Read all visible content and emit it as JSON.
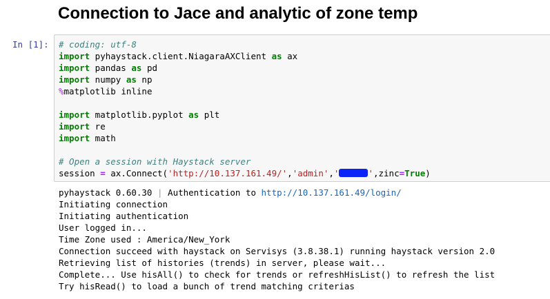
{
  "heading": "Connection to Jace and analytic of zone temp",
  "cell": {
    "prompt": "In [1]:",
    "code": {
      "l1_comment": "# coding: utf-8",
      "kw_import": "import",
      "kw_as": "as",
      "l2_module": " pyhaystack.client.NiagaraAXClient ",
      "l2_alias": " ax",
      "l3_module": " pandas ",
      "l3_alias": " pd",
      "l4_module": " numpy ",
      "l4_alias": " np",
      "l5_magic": "%",
      "l5_rest": "matplotlib inline",
      "l7_module": " matplotlib.pyplot ",
      "l7_alias": " plt",
      "l8_module": " re",
      "l9_module": " math",
      "l11_comment": "# Open a session with Haystack server",
      "l12_a": "session ",
      "l12_eq": "=",
      "l12_b": " ax.Connect(",
      "l12_url": "'http://10.137.161.49/'",
      "l12_comma1": ",",
      "l12_user": "'admin'",
      "l12_comma2": ",",
      "l12_pw_open": "'",
      "l12_pw_close": "'",
      "l12_c": ",zinc",
      "l12_eq2": "=",
      "l12_true": "True",
      "l12_close": ")"
    }
  },
  "output": {
    "line1_a": "pyhaystack 0.60.30 ",
    "line1_sep": "|",
    "line1_b": " Authentication to ",
    "line1_url": "http://10.137.161.49/login/",
    "lines": [
      "Initiating connection",
      "Initiating authentication",
      "User logged in...",
      "Time Zone used : America/New_York",
      "Connection succeed with haystack on Servisys (3.8.38.1) running haystack version 2.0",
      "Retrieving list of histories (trends) in server, please wait...",
      "Complete... Use hisAll() to check for trends or refreshHisList() to refresh the list",
      "Try hisRead() to load a bunch of trend matching criterias"
    ]
  }
}
